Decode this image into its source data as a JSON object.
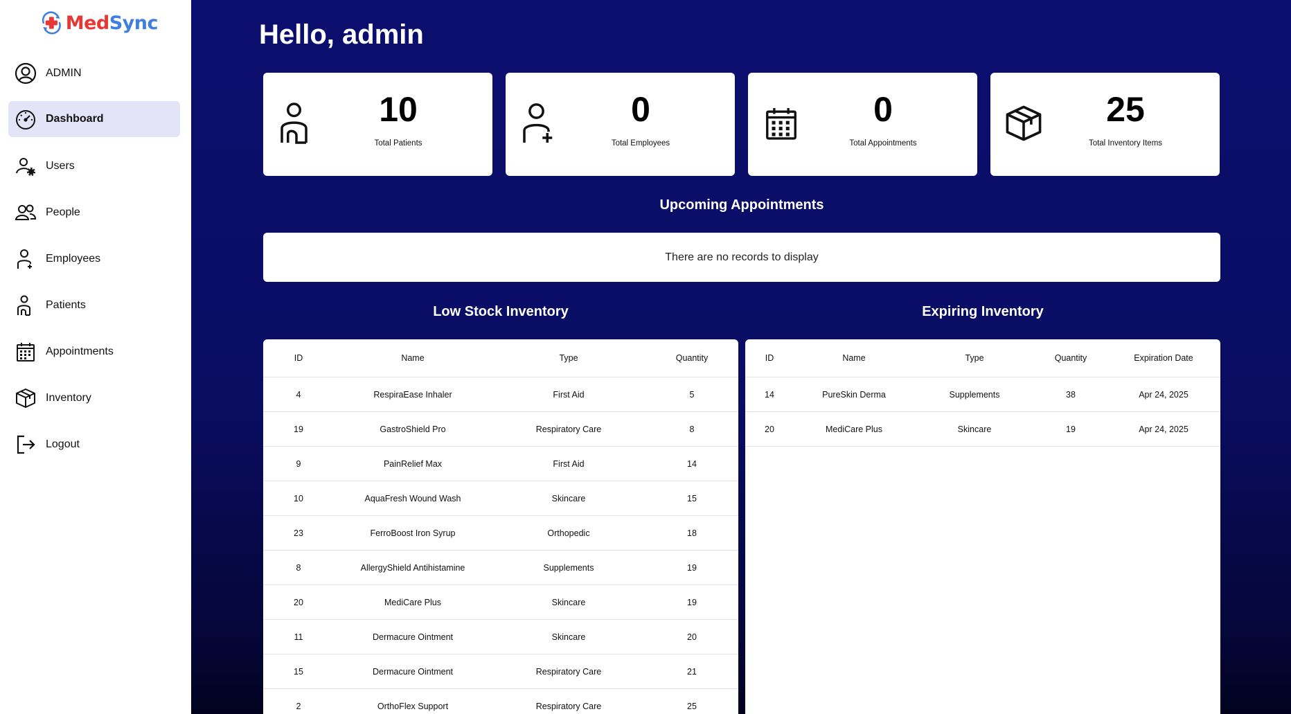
{
  "brand": {
    "part1": "Med",
    "part2": "Sync"
  },
  "sidebar": {
    "items": [
      {
        "label": "ADMIN",
        "icon": "user-circle-icon"
      },
      {
        "label": "Dashboard",
        "icon": "speedometer-icon",
        "active": true
      },
      {
        "label": "Users",
        "icon": "user-gear-icon"
      },
      {
        "label": "People",
        "icon": "people-icon"
      },
      {
        "label": "Employees",
        "icon": "employee-icon"
      },
      {
        "label": "Patients",
        "icon": "patient-icon"
      },
      {
        "label": "Appointments",
        "icon": "calendar-icon"
      },
      {
        "label": "Inventory",
        "icon": "box-icon"
      },
      {
        "label": "Logout",
        "icon": "logout-icon"
      }
    ]
  },
  "header": {
    "greeting": "Hello, admin"
  },
  "stats": [
    {
      "value": "10",
      "label": "Total Patients",
      "icon": "patient-icon"
    },
    {
      "value": "0",
      "label": "Total Employees",
      "icon": "employee-icon"
    },
    {
      "value": "0",
      "label": "Total Appointments",
      "icon": "calendar-icon"
    },
    {
      "value": "25",
      "label": "Total Inventory Items",
      "icon": "box-icon"
    }
  ],
  "appointments": {
    "title": "Upcoming Appointments",
    "empty": "There are no records to display"
  },
  "low_stock": {
    "title": "Low Stock Inventory",
    "columns": [
      "ID",
      "Name",
      "Type",
      "Quantity"
    ],
    "rows": [
      [
        "4",
        "RespiraEase Inhaler",
        "First Aid",
        "5"
      ],
      [
        "19",
        "GastroShield Pro",
        "Respiratory Care",
        "8"
      ],
      [
        "9",
        "PainRelief Max",
        "First Aid",
        "14"
      ],
      [
        "10",
        "AquaFresh Wound Wash",
        "Skincare",
        "15"
      ],
      [
        "23",
        "FerroBoost Iron Syrup",
        "Orthopedic",
        "18"
      ],
      [
        "8",
        "AllergyShield Antihistamine",
        "Supplements",
        "19"
      ],
      [
        "20",
        "MediCare Plus",
        "Skincare",
        "19"
      ],
      [
        "11",
        "Dermacure Ointment",
        "Skincare",
        "20"
      ],
      [
        "15",
        "Dermacure Ointment",
        "Respiratory Care",
        "21"
      ],
      [
        "2",
        "OrthoFlex Support",
        "Respiratory Care",
        "25"
      ]
    ]
  },
  "expiring": {
    "title": "Expiring Inventory",
    "columns": [
      "ID",
      "Name",
      "Type",
      "Quantity",
      "Expiration Date"
    ],
    "rows": [
      [
        "14",
        "PureSkin Derma",
        "Supplements",
        "38",
        "Apr 24, 2025"
      ],
      [
        "20",
        "MediCare Plus",
        "Skincare",
        "19",
        "Apr 24, 2025"
      ]
    ]
  },
  "colors": {
    "main_bg": "#0b0e6e",
    "active_nav": "#e4e4f8",
    "brand_red": "#e53935",
    "brand_blue": "#3f7fe0"
  }
}
